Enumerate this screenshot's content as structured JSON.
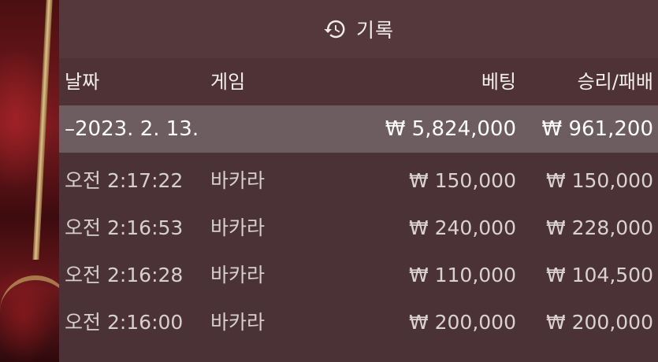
{
  "header": {
    "icon": "history-icon",
    "title": "기록"
  },
  "columns": {
    "date": "날짜",
    "game": "게임",
    "bet": "베팅",
    "win_loss": "승리/패배"
  },
  "summary": {
    "date": "–2023. 2. 13.",
    "bet": "₩ 5,824,000",
    "win_loss": "₩ 961,200"
  },
  "rows": [
    {
      "time": "오전 2:17:22",
      "game": "바카라",
      "bet": "₩ 150,000",
      "win_loss": "₩ 150,000"
    },
    {
      "time": "오전 2:16:53",
      "game": "바카라",
      "bet": "₩ 240,000",
      "win_loss": "₩ 228,000"
    },
    {
      "time": "오전 2:16:28",
      "game": "바카라",
      "bet": "₩ 110,000",
      "win_loss": "₩ 104,500"
    },
    {
      "time": "오전 2:16:00",
      "game": "바카라",
      "bet": "₩ 200,000",
      "win_loss": "₩ 200,000"
    }
  ],
  "colors": {
    "panel": "#4b3236",
    "summary_row": "#6e5d60",
    "text": "#e8e2e2"
  }
}
